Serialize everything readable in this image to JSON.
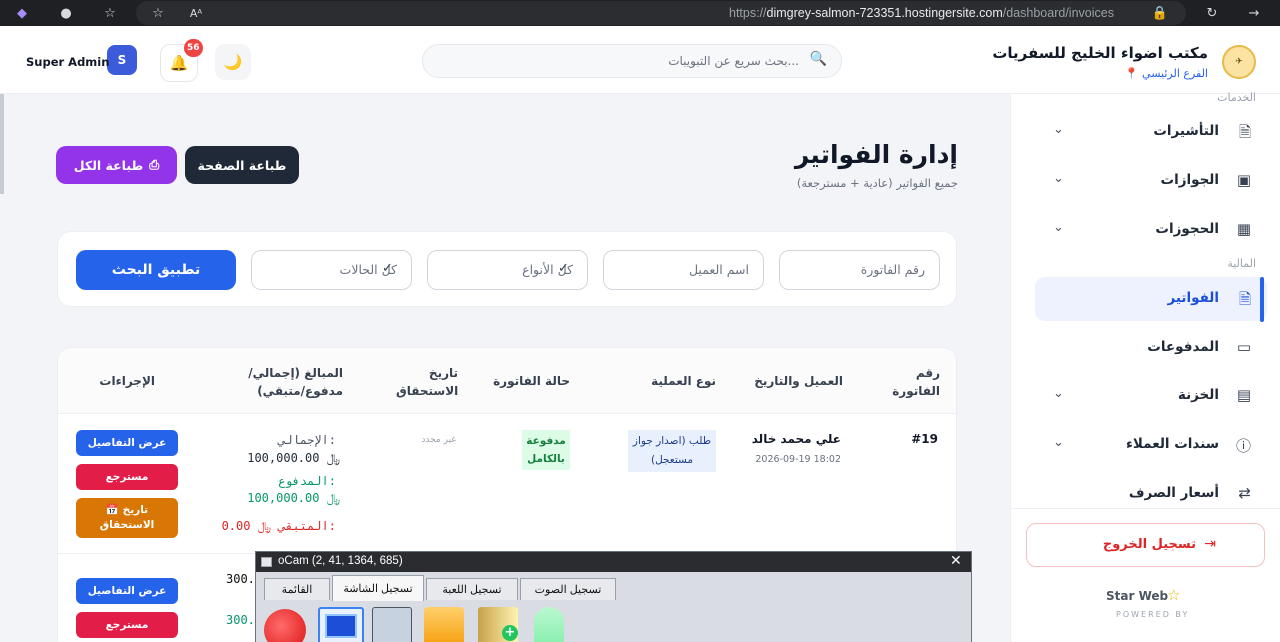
{
  "browser": {
    "url_prefix": "https://",
    "url_host": "dimgrey-salmon-723351.hostingersite.com",
    "url_path": "/dashboard/invoices"
  },
  "header": {
    "org_name": "مكتب اضواء الخليج للسفريات",
    "branch": "📍 الفرع الرئيسي",
    "search_placeholder": "بحث سريع عن التبويبات...",
    "notif_count": "56",
    "user_initial": "S",
    "user_name": "Super Admin"
  },
  "sidebar": {
    "section_services": "الخدمات",
    "section_finance": "المالية",
    "items": [
      {
        "label": "التأشيرات"
      },
      {
        "label": "الجوازات"
      },
      {
        "label": "الحجوزات"
      },
      {
        "label": "الفواتير"
      },
      {
        "label": "المدفوعات"
      },
      {
        "label": "الخزنة"
      },
      {
        "label": "سندات العملاء"
      },
      {
        "label": "أسعار الصرف"
      }
    ],
    "logout": "تسجيل الخروج",
    "brand": "Star Web",
    "powered_by": "POWERED BY"
  },
  "page": {
    "title": "إدارة الفواتير",
    "subtitle": "جميع الفواتير (عادية + مسترجعة)",
    "print_page": "طباعة الصفحة",
    "print_all": "طباعة الكل"
  },
  "filters": {
    "invoice_no_placeholder": "رقم الفاتورة",
    "client_placeholder": "اسم العميل",
    "types": "كل الأنواع",
    "statuses": "كل الحالات",
    "apply": "تطبيق البحث"
  },
  "table": {
    "headers": {
      "invoice_no": "رقم الفاتورة",
      "client_date": "العميل والتاريخ",
      "op_type": "نوع العملية",
      "status": "حالة الفاتورة",
      "due_date": "تاريخ الاستحقاق",
      "amounts": "المبالغ (إجمالي/ مدفوع/متبقي)",
      "actions": "الإجراءات"
    },
    "rows": [
      {
        "invoice_no": "#19",
        "client": "علي محمد خالد",
        "date": "2026-09-19 18:02",
        "op_type": "طلب (اصدار جواز مستعجل)",
        "status": "مدفوعة بالكامل",
        "due": "غير محدد",
        "total_label": "الإجمالي:",
        "total": "100,000.00 ﷼",
        "paid_label": "المدفوع:",
        "paid": "100,000.00 ﷼",
        "rem_label": "المتبقي:",
        "remaining": "0.00 ﷼",
        "btn_details": "عرض التفاصيل",
        "btn_refund": "مسترجع",
        "btn_due_line1": "📅 تاريخ",
        "btn_due_line2": "الاستحقاق"
      },
      {
        "total_partial": "300.",
        "paid_partial": "300.",
        "btn_details": "عرض التفاصيل",
        "btn_refund": "مسترجع"
      }
    ]
  },
  "ocam": {
    "title": "oCam (2, 41, 1364, 685)",
    "tabs": [
      "القائمة",
      "تسجيل الشاشة",
      "تسجيل اللعبة",
      "تسجيل الصوت"
    ]
  }
}
